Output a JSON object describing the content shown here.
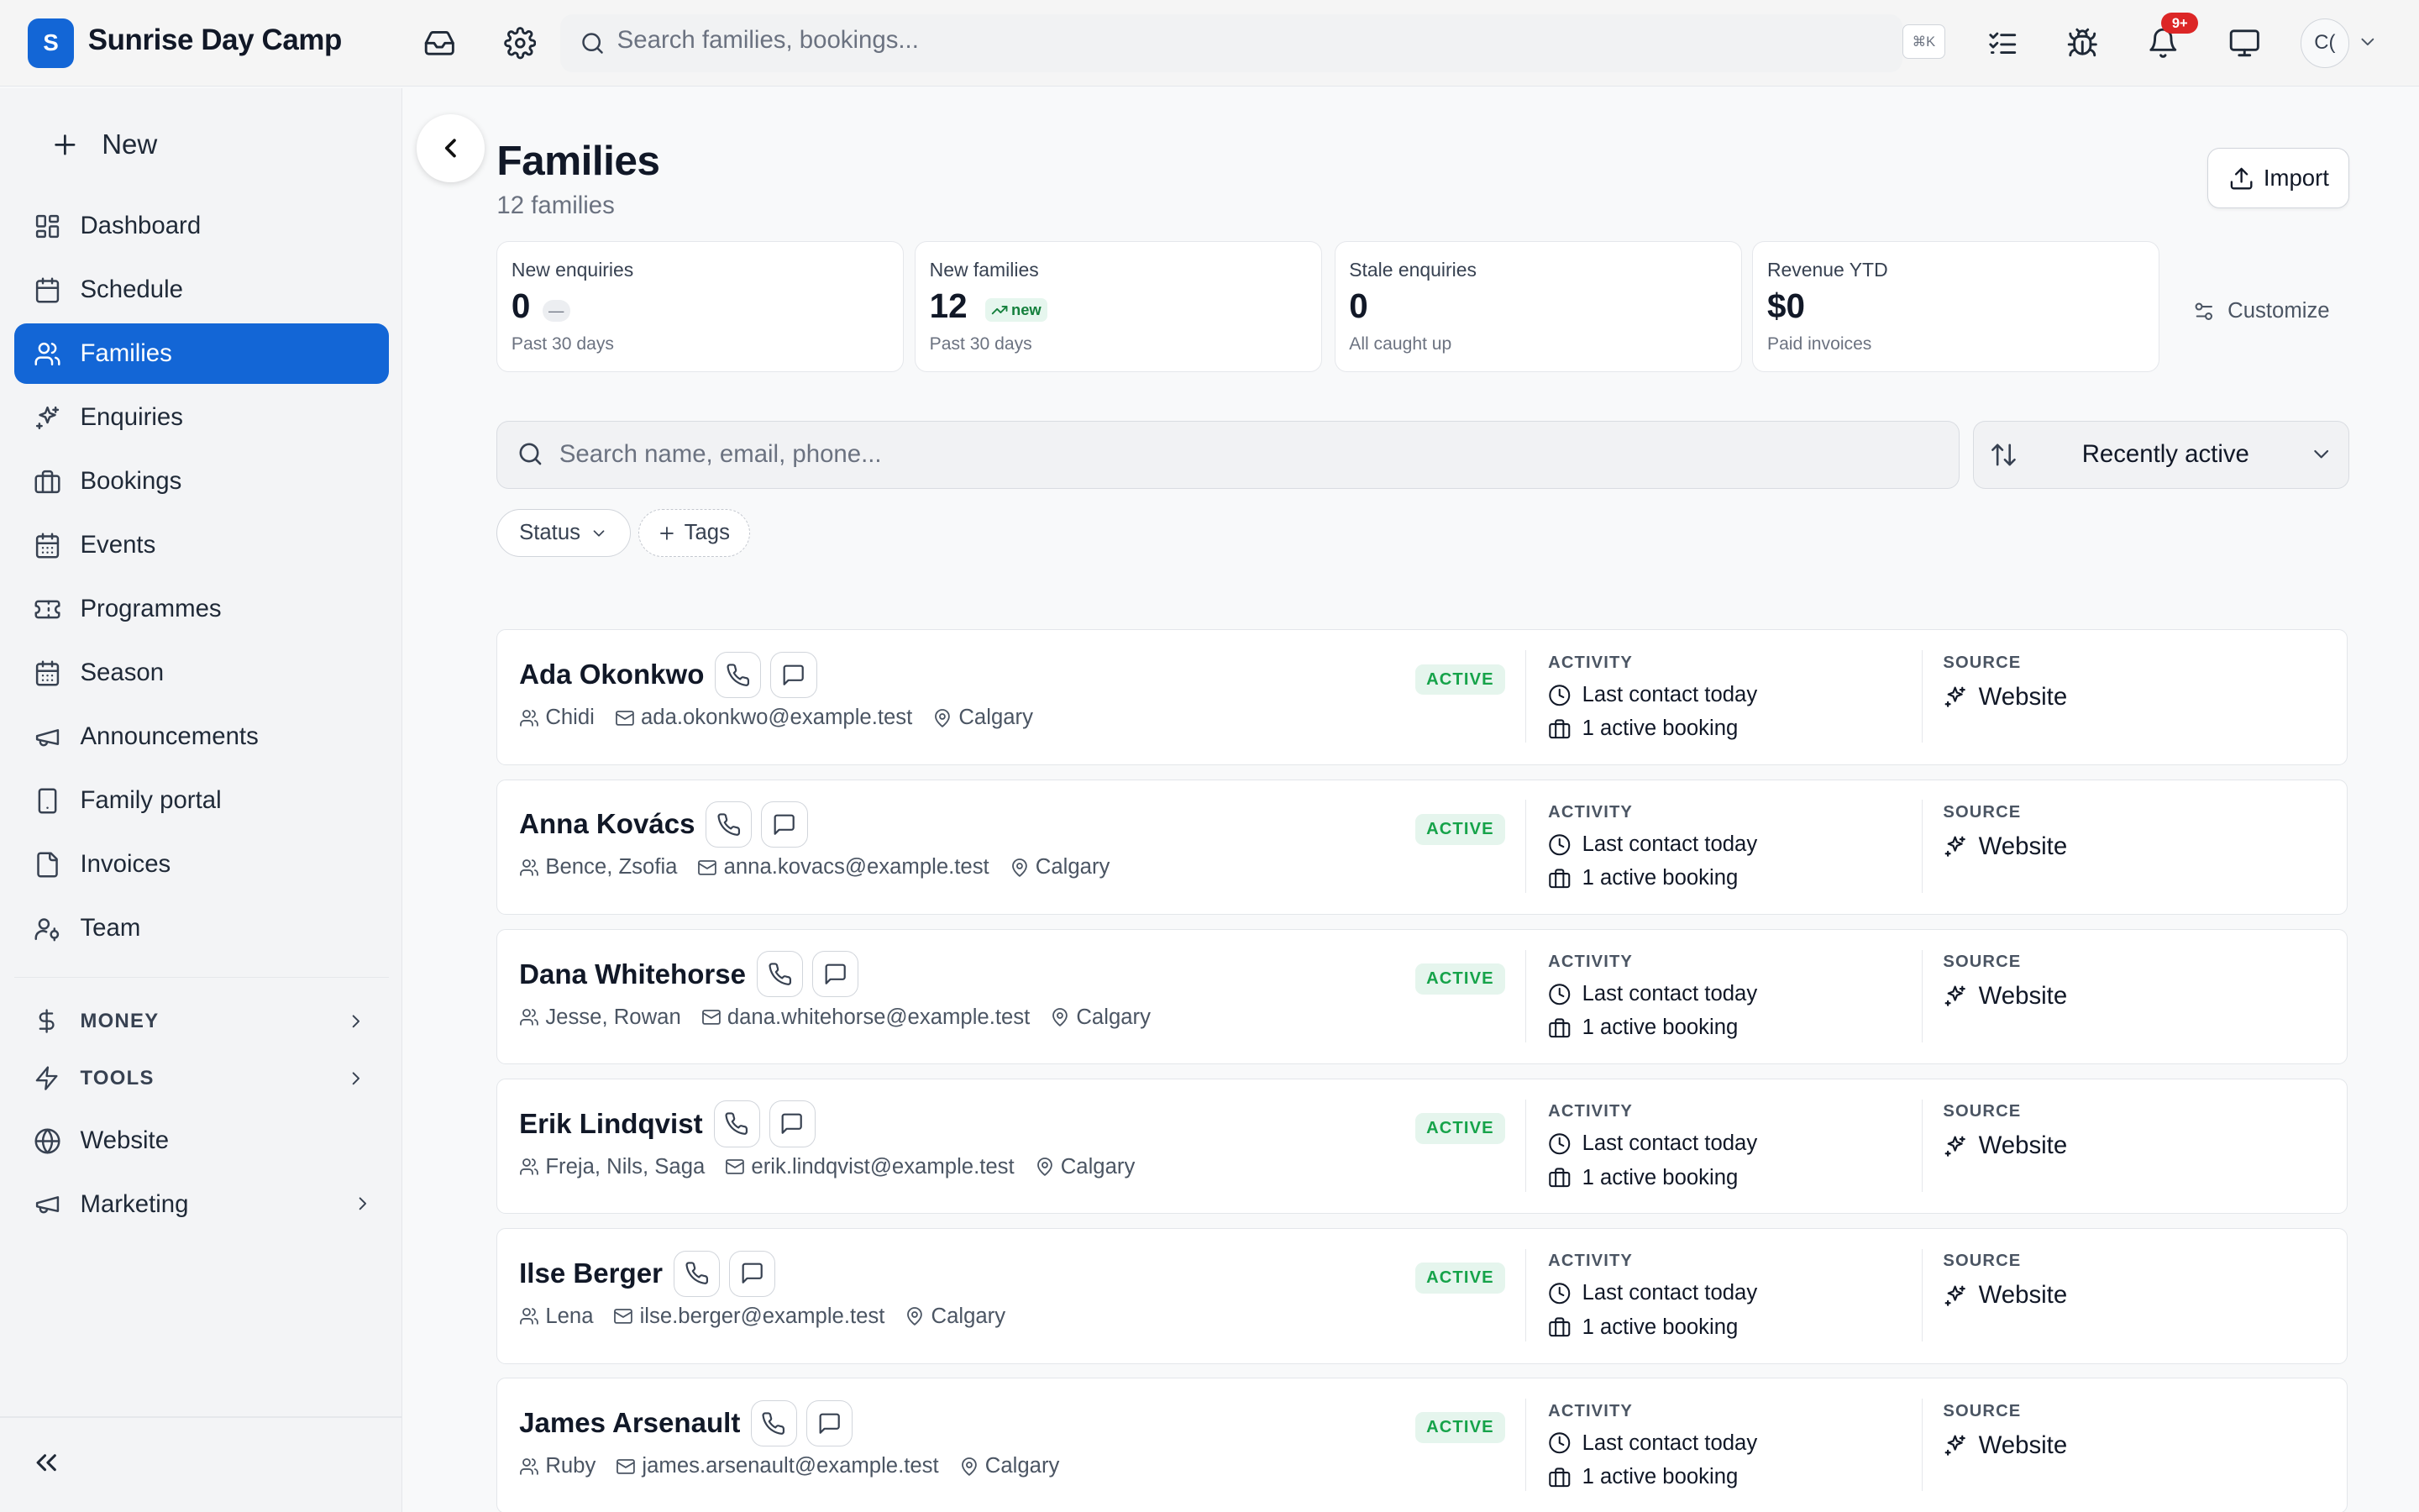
{
  "app": {
    "logo_letter": "S",
    "name": "Sunrise Day Camp"
  },
  "topbar": {
    "search_placeholder": "Search families, bookings...",
    "shortcut": "⌘K",
    "notification_count": "9+",
    "avatar_initials": "C(",
    "icons": [
      "inbox-icon",
      "settings-icon",
      "checklist-icon",
      "bug-icon",
      "bell-icon",
      "monitor-icon"
    ]
  },
  "sidebar": {
    "new_label": "New",
    "items": [
      {
        "label": "Dashboard",
        "icon": "dashboard-icon"
      },
      {
        "label": "Schedule",
        "icon": "calendar-icon"
      },
      {
        "label": "Families",
        "icon": "users-icon",
        "active": true
      },
      {
        "label": "Enquiries",
        "icon": "sparkles-icon"
      },
      {
        "label": "Bookings",
        "icon": "briefcase-icon"
      },
      {
        "label": "Events",
        "icon": "calendar-grid-icon"
      },
      {
        "label": "Programmes",
        "icon": "ticket-icon"
      },
      {
        "label": "Season",
        "icon": "calendar-grid-icon"
      },
      {
        "label": "Announcements",
        "icon": "megaphone-icon"
      },
      {
        "label": "Family portal",
        "icon": "phone-icon"
      },
      {
        "label": "Invoices",
        "icon": "invoice-icon"
      },
      {
        "label": "Team",
        "icon": "team-icon"
      }
    ],
    "sections": [
      {
        "label": "MONEY",
        "icon": "dollar-icon"
      },
      {
        "label": "TOOLS",
        "icon": "lightning-icon"
      }
    ],
    "website_label": "Website",
    "marketing_label": "Marketing"
  },
  "page": {
    "title": "Families",
    "subtitle": "12 families",
    "import_label": "Import",
    "customize_label": "Customize"
  },
  "stats": [
    {
      "label": "New enquiries",
      "value": "0",
      "badge": "—",
      "meta": "Past 30 days"
    },
    {
      "label": "New families",
      "value": "12",
      "badge": "new",
      "meta": "Past 30 days"
    },
    {
      "label": "Stale enquiries",
      "value": "0",
      "meta": "All caught up"
    },
    {
      "label": "Revenue YTD",
      "value": "$0",
      "meta": "Paid invoices"
    }
  ],
  "filters": {
    "search_placeholder": "Search name, email, phone...",
    "sort_label": "Recently active",
    "status_label": "Status",
    "tags_label": "Tags"
  },
  "columns": {
    "activity": "ACTIVITY",
    "source": "SOURCE"
  },
  "families": [
    {
      "name": "Ada Okonkwo",
      "children": "Chidi",
      "email": "ada.okonkwo@example.test",
      "city": "Calgary",
      "status": "ACTIVE",
      "last_contact": "Last contact today",
      "bookings": "1 active booking",
      "source": "Website"
    },
    {
      "name": "Anna Kovács",
      "children": "Bence, Zsofia",
      "email": "anna.kovacs@example.test",
      "city": "Calgary",
      "status": "ACTIVE",
      "last_contact": "Last contact today",
      "bookings": "1 active booking",
      "source": "Website"
    },
    {
      "name": "Dana Whitehorse",
      "children": "Jesse, Rowan",
      "email": "dana.whitehorse@example.test",
      "city": "Calgary",
      "status": "ACTIVE",
      "last_contact": "Last contact today",
      "bookings": "1 active booking",
      "source": "Website"
    },
    {
      "name": "Erik Lindqvist",
      "children": "Freja, Nils, Saga",
      "email": "erik.lindqvist@example.test",
      "city": "Calgary",
      "status": "ACTIVE",
      "last_contact": "Last contact today",
      "bookings": "1 active booking",
      "source": "Website"
    },
    {
      "name": "Ilse Berger",
      "children": "Lena",
      "email": "ilse.berger@example.test",
      "city": "Calgary",
      "status": "ACTIVE",
      "last_contact": "Last contact today",
      "bookings": "1 active booking",
      "source": "Website"
    },
    {
      "name": "James Arsenault",
      "children": "Ruby",
      "email": "james.arsenault@example.test",
      "city": "Calgary",
      "status": "ACTIVE",
      "last_contact": "Last contact today",
      "bookings": "1 active booking",
      "source": "Website"
    }
  ],
  "colors": {
    "accent": "#1366d6",
    "active_badge_bg": "#e5f5ed",
    "active_badge_text": "#16a34a",
    "notification": "#dc2626"
  }
}
